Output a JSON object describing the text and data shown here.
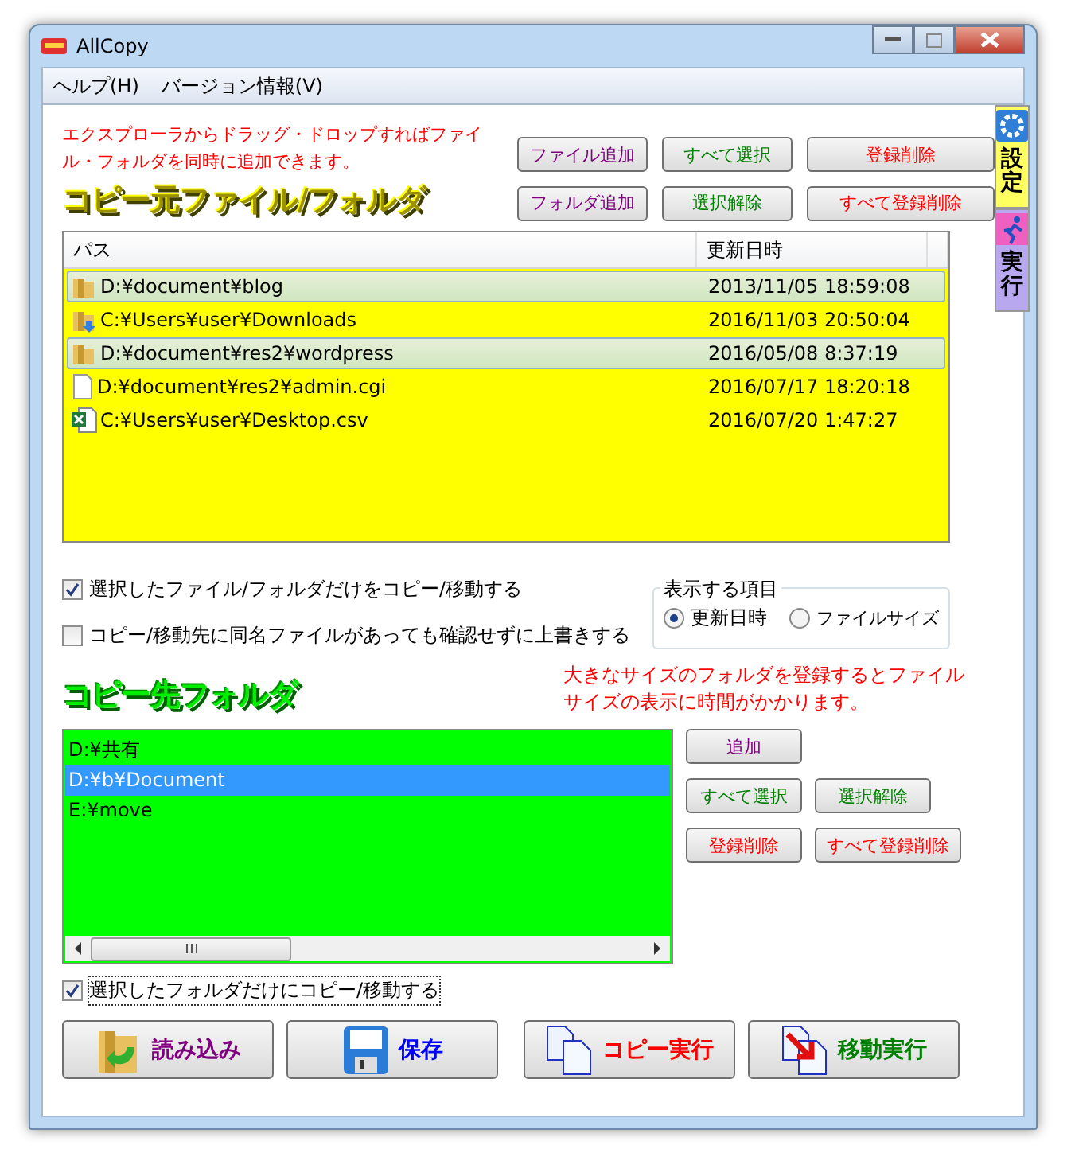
{
  "window": {
    "title": "AllCopy"
  },
  "menu": [
    "ヘルプ(H)",
    "バージョン情報(V)"
  ],
  "side_tabs": [
    {
      "label": "設定",
      "kind": "settings",
      "selected": true
    },
    {
      "label": "実行",
      "kind": "run",
      "selected": false
    }
  ],
  "hint": "エクスプローラからドラッグ・ドロップすればファイル・フォルダを同時に追加できます。",
  "source_buttons": [
    {
      "label": "ファイル追加",
      "kind": "add"
    },
    {
      "label": "すべて選択",
      "kind": "select"
    },
    {
      "label": "登録削除",
      "kind": "delete"
    },
    {
      "label": "フォルダ追加",
      "kind": "add"
    },
    {
      "label": "選択解除",
      "kind": "select"
    },
    {
      "label": "すべて登録削除",
      "kind": "delete"
    }
  ],
  "source_heading": "コピー元ファイル/フォルダ",
  "source_table": {
    "columns": [
      "パス",
      "更新日時"
    ],
    "rows": [
      {
        "path": "D:¥document¥blog",
        "modified": "2013/11/05 18:59:08",
        "kind": "folder",
        "selected": true
      },
      {
        "path": "C:¥Users¥user¥Downloads",
        "modified": "2016/11/03 20:50:04",
        "kind": "download-folder",
        "selected": false
      },
      {
        "path": "D:¥document¥res2¥wordpress",
        "modified": "2016/05/08 8:37:19",
        "kind": "folder",
        "selected": true
      },
      {
        "path": "D:¥document¥res2¥admin.cgi",
        "modified": "2016/07/17 18:20:18",
        "kind": "file",
        "selected": false
      },
      {
        "path": "C:¥Users¥user¥Desktop.csv",
        "modified": "2016/07/20 1:47:27",
        "kind": "spreadsheet",
        "selected": false
      }
    ]
  },
  "options": [
    {
      "label": "選択したファイル/フォルダだけをコピー/移動する",
      "checked": true
    },
    {
      "label": "コピー/移動先に同名ファイルがあっても確認せずに上書きする",
      "checked": false
    }
  ],
  "display_group": {
    "title": "表示する項目",
    "choices": [
      {
        "label": "更新日時",
        "selected": true
      },
      {
        "label": "ファイルサイズ",
        "selected": false
      }
    ]
  },
  "warning": "大きなサイズのフォルダを登録するとファイルサイズの表示に時間がかかります。",
  "dest_heading": "コピー先フォルダ",
  "dest_list": [
    {
      "path": "D:¥共有",
      "selected": false
    },
    {
      "path": "D:¥b¥Document",
      "selected": true
    },
    {
      "path": "E:¥move",
      "selected": false
    }
  ],
  "dest_buttons": [
    {
      "label": "追加",
      "kind": "add"
    },
    {
      "label": "すべて選択",
      "kind": "select"
    },
    {
      "label": "選択解除",
      "kind": "select"
    },
    {
      "label": "登録削除",
      "kind": "delete"
    },
    {
      "label": "すべて登録削除",
      "kind": "delete"
    }
  ],
  "dest_option": {
    "label": "選択したフォルダだけにコピー/移動する",
    "checked": true
  },
  "actions": [
    {
      "label": "読み込み",
      "kind": "load"
    },
    {
      "label": "保存",
      "kind": "save"
    },
    {
      "label": "コピー実行",
      "kind": "copy"
    },
    {
      "label": "移動実行",
      "kind": "move"
    }
  ]
}
